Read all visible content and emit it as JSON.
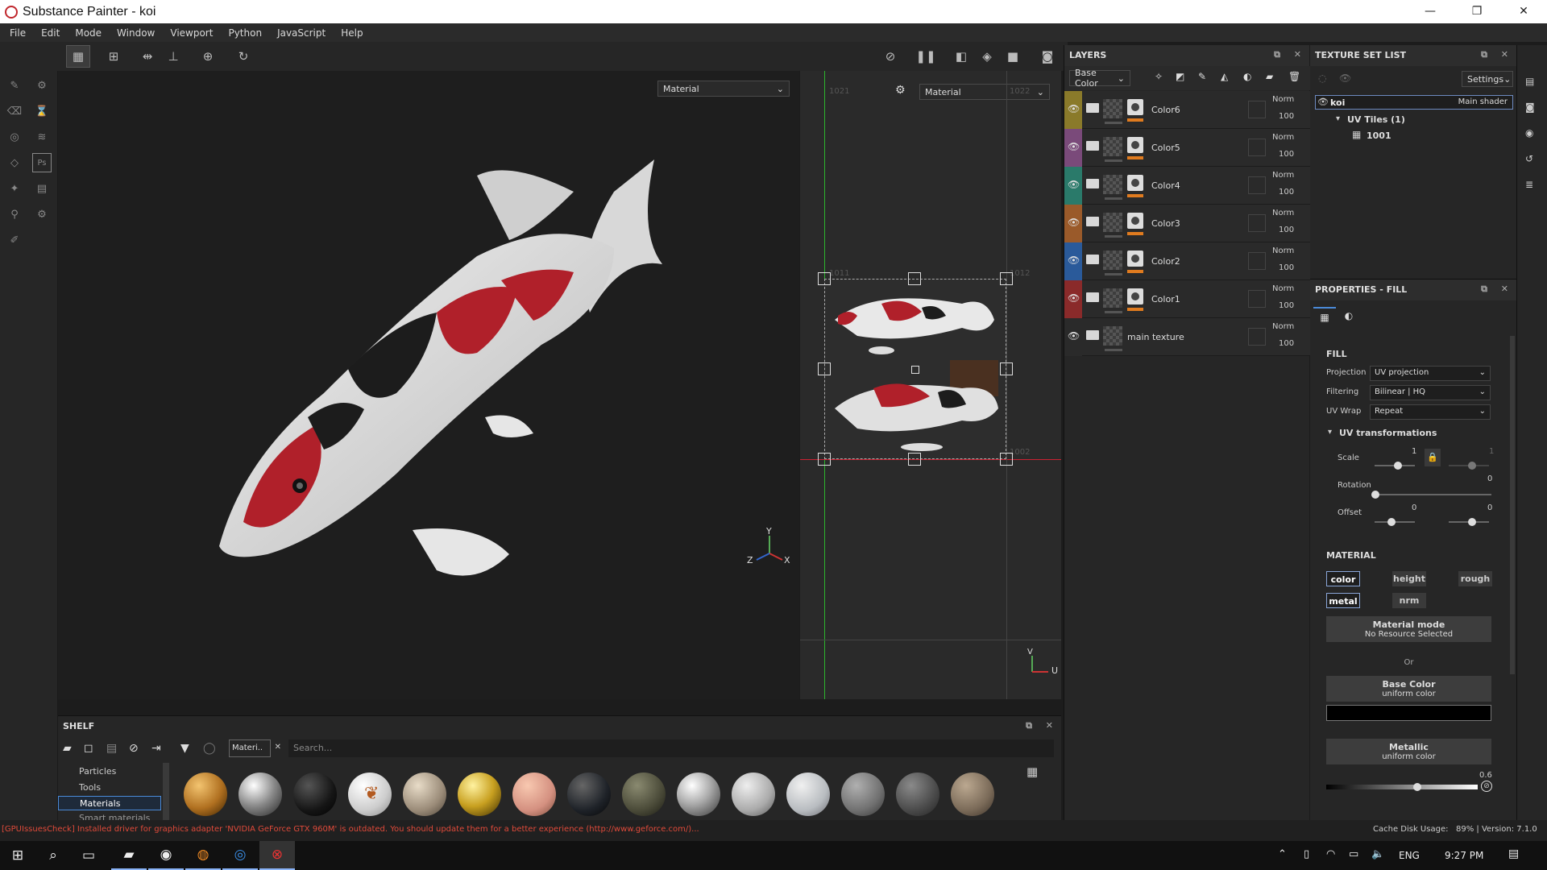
{
  "window": {
    "title": "Substance Painter - koi",
    "minimize": "—",
    "maximize": "❐",
    "close": "✕"
  },
  "menu": [
    "File",
    "Edit",
    "Mode",
    "Window",
    "Viewport",
    "Python",
    "JavaScript",
    "Help"
  ],
  "viewport3d": {
    "mode_select": "Material",
    "axis_y": "Y",
    "axis_z": "Z",
    "axis_x": "X"
  },
  "viewport2d": {
    "mode_select": "Material",
    "tile_1021": "1021",
    "tile_1022": "1022",
    "tile_1011": "1011",
    "tile_1012": "1012",
    "tile_1001": "1001",
    "tile_1002": "1002",
    "axis_v": "V",
    "axis_u": "U"
  },
  "layers": {
    "title": "LAYERS",
    "channel_select": "Base Color",
    "items": [
      {
        "name": "Color6",
        "blend": "Norm",
        "opacity": "100",
        "color": "#8a7a2a"
      },
      {
        "name": "Color5",
        "blend": "Norm",
        "opacity": "100",
        "color": "#7a4a7a"
      },
      {
        "name": "Color4",
        "blend": "Norm",
        "opacity": "100",
        "color": "#2a7a6a"
      },
      {
        "name": "Color3",
        "blend": "Norm",
        "opacity": "100",
        "color": "#9a5a2a"
      },
      {
        "name": "Color2",
        "blend": "Norm",
        "opacity": "100",
        "color": "#2a5a9a"
      },
      {
        "name": "Color1",
        "blend": "Norm",
        "opacity": "100",
        "color": "#8a2a2a"
      },
      {
        "name": "main texture",
        "blend": "Norm",
        "opacity": "100",
        "color": "#2a2a2a"
      }
    ]
  },
  "texture_set_list": {
    "title": "TEXTURE SET LIST",
    "settings": "Settings",
    "set_name": "koi",
    "shader": "Main shader",
    "uv_tiles": "UV Tiles (1)",
    "tile": "1001"
  },
  "properties": {
    "title": "PROPERTIES - FILL",
    "fill_heading": "FILL",
    "projection_label": "Projection",
    "projection_value": "UV projection",
    "filtering_label": "Filtering",
    "filtering_value": "Bilinear | HQ",
    "uvwrap_label": "UV Wrap",
    "uvwrap_value": "Repeat",
    "uv_transformations": "UV transformations",
    "scale_label": "Scale",
    "scale_value_1": "1",
    "scale_value_2": "1",
    "rotation_label": "Rotation",
    "rotation_value": "0",
    "offset_label": "Offset",
    "offset_value_1": "0",
    "offset_value_2": "0",
    "material_heading": "MATERIAL",
    "channels": [
      "color",
      "height",
      "rough",
      "metal",
      "nrm"
    ],
    "material_mode": "Material mode",
    "material_mode_sub": "No Resource Selected",
    "or": "Or",
    "base_color": "Base Color",
    "base_color_sub": "uniform color",
    "base_color_hex": "#000000",
    "metallic": "Metallic",
    "metallic_sub": "uniform color",
    "metallic_value": "0.6"
  },
  "shelf": {
    "title": "SHELF",
    "filter_tag": "Materi..",
    "search_placeholder": "Search...",
    "categories": [
      "Particles",
      "Tools",
      "Materials",
      "Smart materials"
    ],
    "selected_category": "Materials"
  },
  "status": {
    "warning": "[GPUIssuesCheck] Installed driver for graphics adapter 'NVIDIA GeForce GTX 960M' is outdated. You should update them for a better experience (http://www.geforce.com/)...",
    "cache": "Cache Disk Usage:",
    "version": "89% | Version: 7.1.0"
  },
  "taskbar": {
    "lang": "ENG",
    "time": "9:27 PM"
  }
}
